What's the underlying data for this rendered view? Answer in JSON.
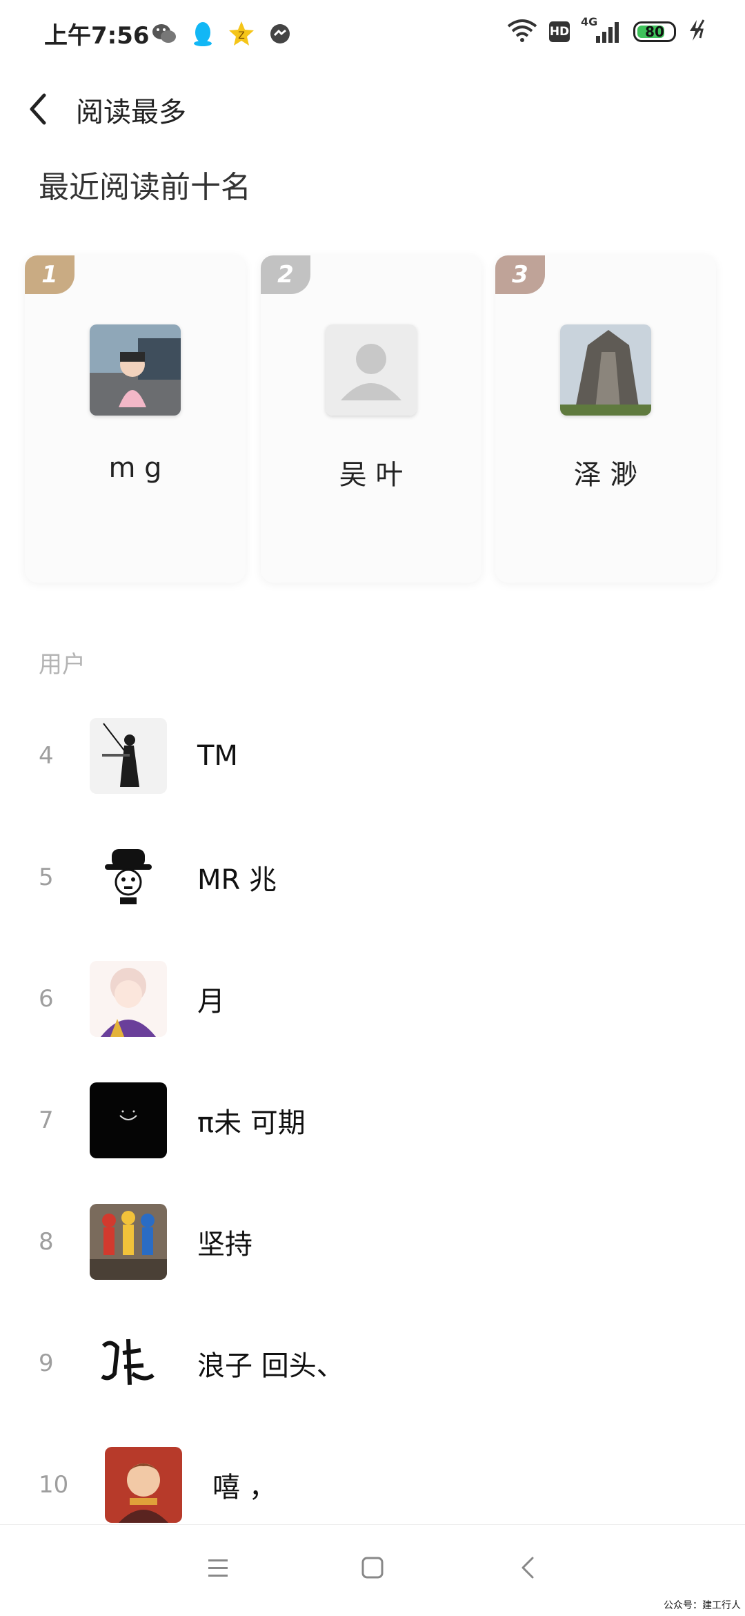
{
  "status_bar": {
    "time": "上午7:56",
    "left_icons": [
      "wechat-icon",
      "qq-icon",
      "star-app-icon",
      "messenger-icon"
    ],
    "network_hd": "HD",
    "network_type": "4G",
    "battery_level": "80"
  },
  "header": {
    "title": "阅读最多"
  },
  "top_section": {
    "title": "最近阅读前十名",
    "cards": [
      {
        "rank": "1",
        "name": "m    g",
        "badge_color": "#c9ab83"
      },
      {
        "rank": "2",
        "name": "吴   叶",
        "badge_color": "#c2c2c2"
      },
      {
        "rank": "3",
        "name": "泽    渺",
        "badge_color": "#bfa398"
      }
    ]
  },
  "list": {
    "label": "用户",
    "rows": [
      {
        "rank": "4",
        "name": "TM"
      },
      {
        "rank": "5",
        "name": "MR    兆"
      },
      {
        "rank": "6",
        "name": "月"
      },
      {
        "rank": "7",
        "name": "π未    可期"
      },
      {
        "rank": "8",
        "name": "坚持"
      },
      {
        "rank": "9",
        "name": "浪子  回头、"
      },
      {
        "rank": "10",
        "name": "嘻    ，"
      }
    ]
  },
  "nav": {
    "buttons": [
      "menu-icon",
      "home-square-icon",
      "back-chevron-icon"
    ]
  },
  "watermark": "公众号：建工行人"
}
